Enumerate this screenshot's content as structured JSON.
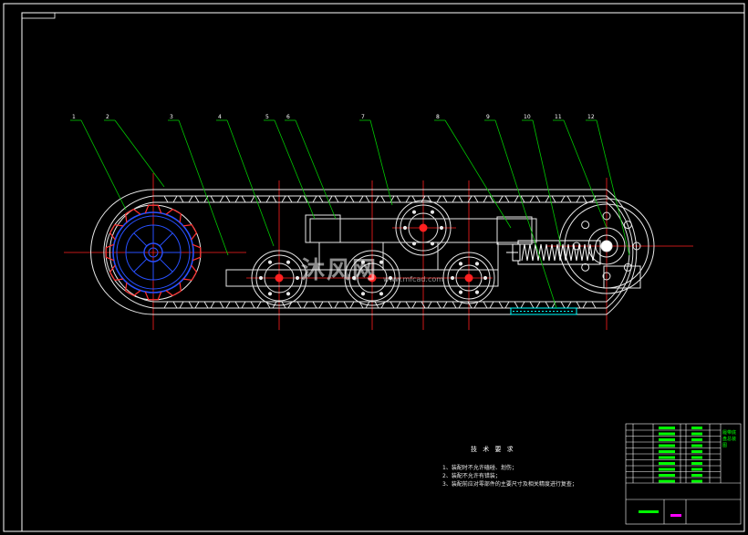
{
  "drawing": {
    "part_labels": [
      "1",
      "2",
      "3",
      "4",
      "5",
      "6",
      "7",
      "8",
      "9",
      "10",
      "11",
      "12"
    ],
    "colors": {
      "background": "#000000",
      "border": "#ffffff",
      "track": "#e8e8e8",
      "leader": "#00c800",
      "centerline": "#ff2020",
      "sprocket": "#2850ff",
      "spring": "#ffffff",
      "plate": "#00ffff",
      "title_block": "#00ff00",
      "magenta": "#ff00ff"
    }
  },
  "technical_requirements": {
    "title": "技 术 要 求",
    "items": [
      "1、装配时不允许磕碰、划伤；",
      "2、装配不允许有错装；",
      "3、装配前应对零部件的主要尺寸及相关精度进行复查；"
    ]
  },
  "watermark": {
    "text": "沐风网",
    "sub": "www.mfcad.com"
  },
  "title_block": {
    "drawing_name": "履带底盘总装图"
  }
}
